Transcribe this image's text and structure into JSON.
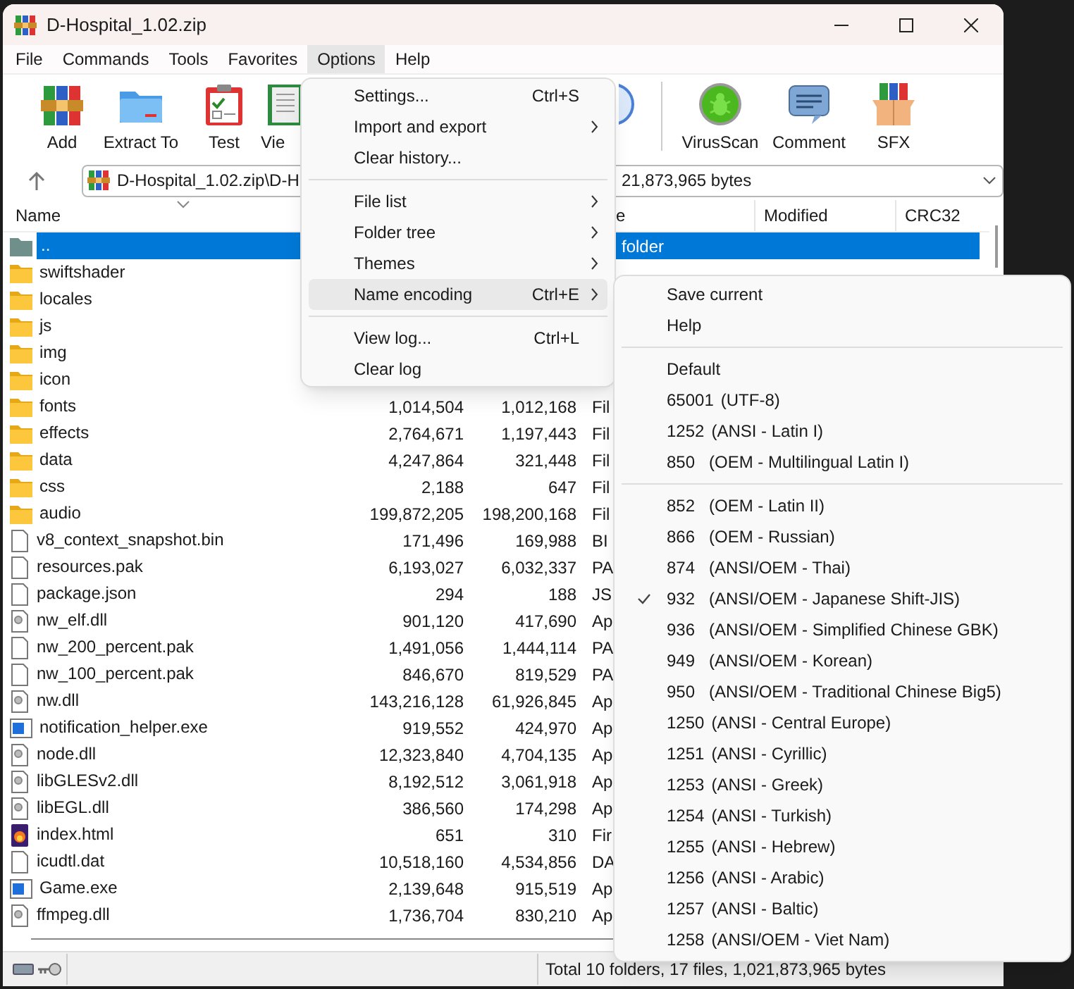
{
  "window": {
    "title": "D-Hospital_1.02.zip"
  },
  "menu_bar": [
    {
      "label": "File",
      "selected": false
    },
    {
      "label": "Commands",
      "selected": false
    },
    {
      "label": "Tools",
      "selected": false
    },
    {
      "label": "Favorites",
      "selected": false
    },
    {
      "label": "Options",
      "selected": true
    },
    {
      "label": "Help",
      "selected": false
    }
  ],
  "toolbar": [
    {
      "kind": "add",
      "label": "Add"
    },
    {
      "kind": "extract",
      "label": "Extract To"
    },
    {
      "kind": "test",
      "label": "Test"
    },
    {
      "kind": "view",
      "label": "Vie"
    },
    {
      "kind": "info"
    },
    {
      "kind": "separator"
    },
    {
      "kind": "virus",
      "label": "VirusScan"
    },
    {
      "kind": "comment",
      "label": "Comment"
    },
    {
      "kind": "sfx",
      "label": "SFX"
    }
  ],
  "address": {
    "path": "D-Hospital_1.02.zip\\D-H",
    "info": "21,873,965 bytes"
  },
  "table": {
    "columns": [
      "Name",
      "",
      "",
      "e",
      "Modified",
      "CRC32"
    ],
    "rows": [
      {
        "kind": "parent",
        "name": "..",
        "type": "folder",
        "selected": true
      },
      {
        "kind": "folder",
        "name": "swiftshader",
        "selected": false
      },
      {
        "kind": "folder",
        "name": "locales",
        "selected": false
      },
      {
        "kind": "folder",
        "name": "js",
        "selected": false
      },
      {
        "kind": "folder",
        "name": "img",
        "selected": false
      },
      {
        "kind": "folder",
        "name": "icon",
        "selected": false
      },
      {
        "kind": "folder",
        "name": "fonts",
        "size": "1,014,504",
        "packed": "1,012,168",
        "type": "Fil",
        "selected": false
      },
      {
        "kind": "folder",
        "name": "effects",
        "size": "2,764,671",
        "packed": "1,197,443",
        "type": "Fil",
        "selected": false
      },
      {
        "kind": "folder",
        "name": "data",
        "size": "4,247,864",
        "packed": "321,448",
        "type": "Fil",
        "selected": false
      },
      {
        "kind": "folder",
        "name": "css",
        "size": "2,188",
        "packed": "647",
        "type": "Fil",
        "selected": false
      },
      {
        "kind": "folder",
        "name": "audio",
        "size": "199,872,205",
        "packed": "198,200,168",
        "type": "Fil",
        "selected": false
      },
      {
        "kind": "file",
        "name": "v8_context_snapshot.bin",
        "size": "171,496",
        "packed": "169,988",
        "type": "BI",
        "selected": false
      },
      {
        "kind": "file",
        "name": "resources.pak",
        "size": "6,193,027",
        "packed": "6,032,337",
        "type": "PA",
        "selected": false
      },
      {
        "kind": "file",
        "name": "package.json",
        "size": "294",
        "packed": "188",
        "type": "JS",
        "selected": false
      },
      {
        "kind": "dll",
        "name": "nw_elf.dll",
        "size": "901,120",
        "packed": "417,690",
        "type": "Ap",
        "selected": false
      },
      {
        "kind": "file",
        "name": "nw_200_percent.pak",
        "size": "1,491,056",
        "packed": "1,444,114",
        "type": "PA",
        "selected": false
      },
      {
        "kind": "file",
        "name": "nw_100_percent.pak",
        "size": "846,670",
        "packed": "819,529",
        "type": "PA",
        "selected": false
      },
      {
        "kind": "dll",
        "name": "nw.dll",
        "size": "143,216,128",
        "packed": "61,926,845",
        "type": "Ap",
        "selected": false
      },
      {
        "kind": "exe",
        "name": "notification_helper.exe",
        "size": "919,552",
        "packed": "424,970",
        "type": "Ap",
        "selected": false
      },
      {
        "kind": "dll",
        "name": "node.dll",
        "size": "12,323,840",
        "packed": "4,704,135",
        "type": "Ap",
        "selected": false
      },
      {
        "kind": "dll",
        "name": "libGLESv2.dll",
        "size": "8,192,512",
        "packed": "3,061,918",
        "type": "Ap",
        "selected": false
      },
      {
        "kind": "dll",
        "name": "libEGL.dll",
        "size": "386,560",
        "packed": "174,298",
        "type": "Ap",
        "selected": false
      },
      {
        "kind": "html",
        "name": "index.html",
        "size": "651",
        "packed": "310",
        "type": "Fir",
        "selected": false
      },
      {
        "kind": "file",
        "name": "icudtl.dat",
        "size": "10,518,160",
        "packed": "4,534,856",
        "type": "DA",
        "selected": false
      },
      {
        "kind": "exe",
        "name": "Game.exe",
        "size": "2,139,648",
        "packed": "915,519",
        "type": "Ap",
        "selected": false
      },
      {
        "kind": "dll",
        "name": "ffmpeg.dll",
        "size": "1,736,704",
        "packed": "830,210",
        "type": "Ap",
        "selected": false
      }
    ]
  },
  "status_bar": {
    "text": "Total 10 folders, 17 files, 1,021,873,965 bytes"
  },
  "options_menu": [
    {
      "kind": "item",
      "label": "Settings...",
      "shortcut": "Ctrl+S",
      "submenu": false,
      "selected": false
    },
    {
      "kind": "item",
      "label": "Import and export",
      "submenu": true,
      "selected": false
    },
    {
      "kind": "item",
      "label": "Clear history...",
      "submenu": false,
      "selected": false
    },
    {
      "kind": "separator"
    },
    {
      "kind": "item",
      "label": "File list",
      "submenu": true,
      "selected": false
    },
    {
      "kind": "item",
      "label": "Folder tree",
      "submenu": true,
      "selected": false
    },
    {
      "kind": "item",
      "label": "Themes",
      "submenu": true,
      "selected": false
    },
    {
      "kind": "item",
      "label": "Name encoding",
      "shortcut": "Ctrl+E",
      "submenu": true,
      "selected": true
    },
    {
      "kind": "separator"
    },
    {
      "kind": "item",
      "label": "View log...",
      "shortcut": "Ctrl+L",
      "submenu": false,
      "selected": false
    },
    {
      "kind": "item",
      "label": "Clear log",
      "submenu": false,
      "selected": false
    }
  ],
  "encoding_menu": [
    {
      "kind": "item",
      "label": "Save current",
      "checked": false
    },
    {
      "kind": "item",
      "label": "Help",
      "checked": false
    },
    {
      "kind": "separator"
    },
    {
      "kind": "item",
      "label": "Default",
      "checked": false
    },
    {
      "kind": "item",
      "code": "65001",
      "label": "(UTF-8)",
      "checked": false
    },
    {
      "kind": "item",
      "code": "1252",
      "label": "(ANSI - Latin I)",
      "checked": false
    },
    {
      "kind": "item",
      "code": "850",
      "label": "(OEM - Multilingual Latin I)",
      "checked": false
    },
    {
      "kind": "separator"
    },
    {
      "kind": "item",
      "code": "852",
      "label": "(OEM - Latin II)",
      "checked": false
    },
    {
      "kind": "item",
      "code": "866",
      "label": "(OEM - Russian)",
      "checked": false
    },
    {
      "kind": "item",
      "code": "874",
      "label": "(ANSI/OEM - Thai)",
      "checked": false
    },
    {
      "kind": "item",
      "code": "932",
      "label": "(ANSI/OEM - Japanese Shift-JIS)",
      "checked": true
    },
    {
      "kind": "item",
      "code": "936",
      "label": "(ANSI/OEM - Simplified Chinese GBK)",
      "checked": false
    },
    {
      "kind": "item",
      "code": "949",
      "label": "(ANSI/OEM - Korean)",
      "checked": false
    },
    {
      "kind": "item",
      "code": "950",
      "label": "(ANSI/OEM - Traditional Chinese Big5)",
      "checked": false
    },
    {
      "kind": "item",
      "code": "1250",
      "label": "(ANSI - Central Europe)",
      "checked": false
    },
    {
      "kind": "item",
      "code": "1251",
      "label": "(ANSI - Cyrillic)",
      "checked": false
    },
    {
      "kind": "item",
      "code": "1253",
      "label": "(ANSI - Greek)",
      "checked": false
    },
    {
      "kind": "item",
      "code": "1254",
      "label": "(ANSI - Turkish)",
      "checked": false
    },
    {
      "kind": "item",
      "code": "1255",
      "label": "(ANSI - Hebrew)",
      "checked": false
    },
    {
      "kind": "item",
      "code": "1256",
      "label": "(ANSI - Arabic)",
      "checked": false
    },
    {
      "kind": "item",
      "code": "1257",
      "label": "(ANSI - Baltic)",
      "checked": false
    },
    {
      "kind": "item",
      "code": "1258",
      "label": "(ANSI/OEM - Viet Nam)",
      "checked": false
    }
  ]
}
